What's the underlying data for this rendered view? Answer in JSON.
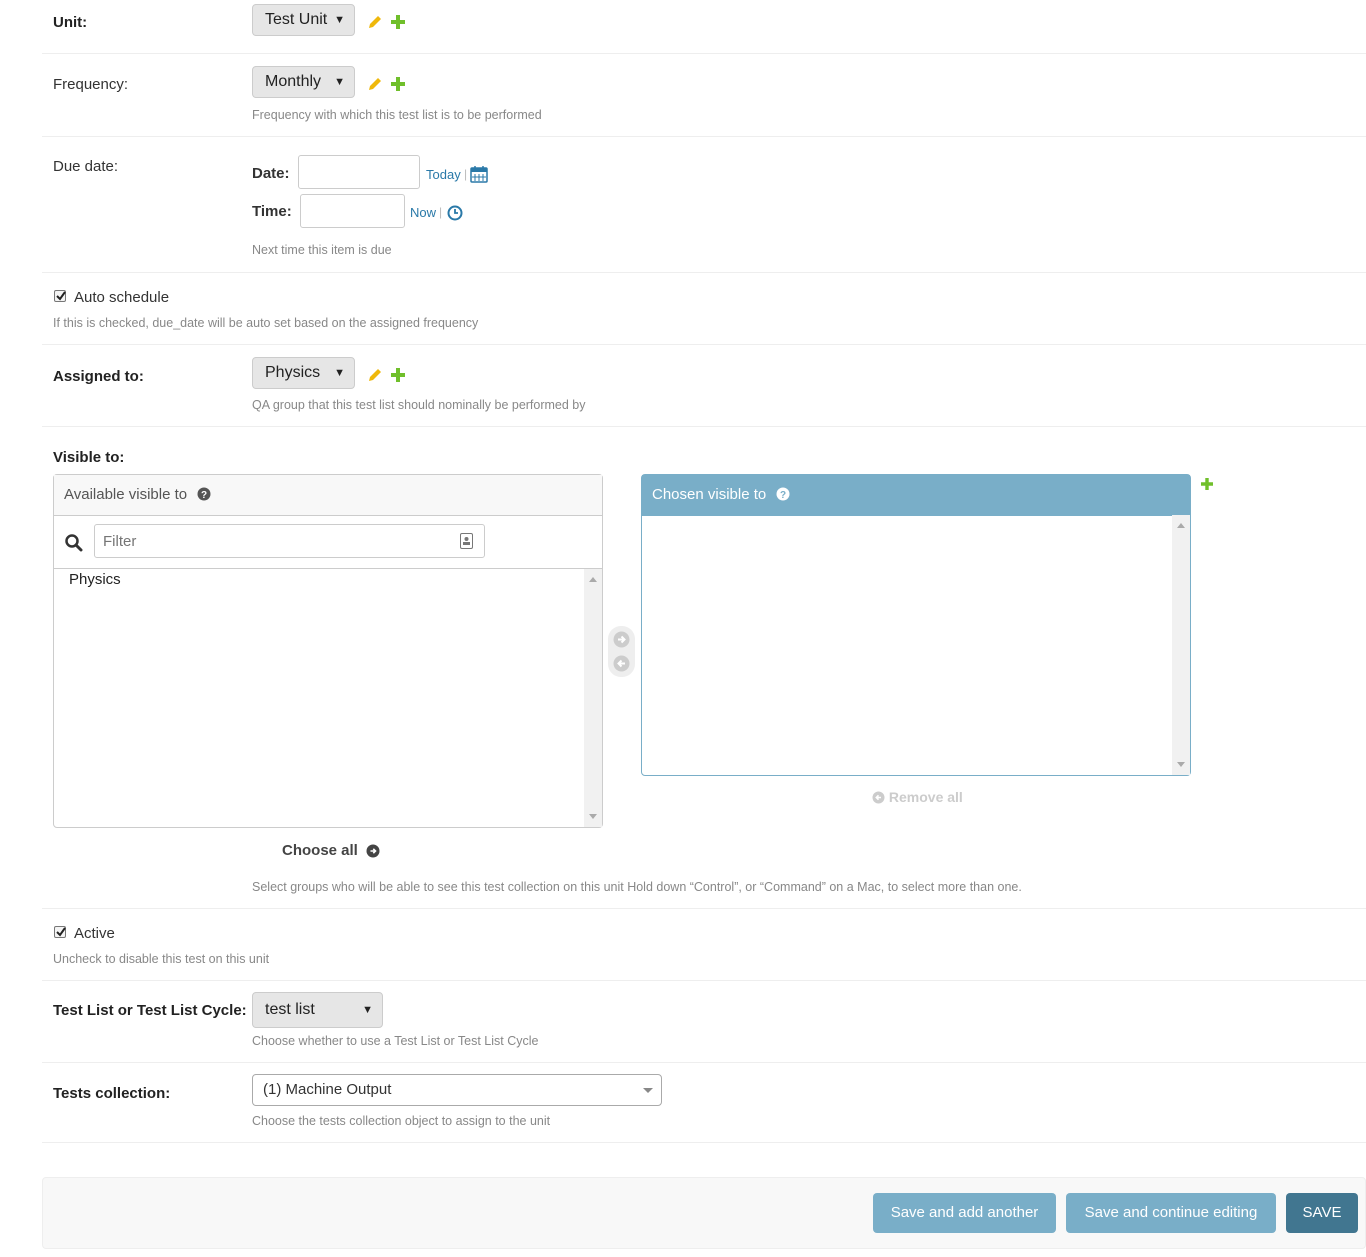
{
  "unit": {
    "label": "Unit:",
    "value": "Test Unit"
  },
  "frequency": {
    "label": "Frequency:",
    "value": "Monthly",
    "help": "Frequency with which this test list is to be performed"
  },
  "due_date": {
    "label": "Due date:",
    "date_label": "Date:",
    "date_value": "",
    "today_link": "Today",
    "separator": "|",
    "time_label": "Time:",
    "time_value": "",
    "now_link": "Now",
    "help": "Next time this item is due"
  },
  "auto_schedule": {
    "label": "Auto schedule",
    "checked": true,
    "help": "If this is checked, due_date will be auto set based on the assigned frequency"
  },
  "assigned_to": {
    "label": "Assigned to:",
    "value": "Physics",
    "help": "QA group that this test list should nominally be performed by"
  },
  "visible_to": {
    "label": "Visible to:",
    "available_title": "Available visible to",
    "filter_placeholder": "Filter",
    "available_items": [
      "Physics"
    ],
    "chosen_title": "Chosen visible to",
    "chosen_items": [],
    "choose_all": "Choose all",
    "remove_all": "Remove all",
    "help": "Select groups who will be able to see this test collection on this unit Hold down “Control”, or “Command” on a Mac, to select more than one."
  },
  "active": {
    "label": "Active",
    "checked": true,
    "help": "Uncheck to disable this test on this unit"
  },
  "test_list_type": {
    "label": "Test List or Test List Cycle:",
    "value": "test list",
    "help": "Choose whether to use a Test List or Test List Cycle"
  },
  "tests_collection": {
    "label": "Tests collection:",
    "value": "(1) Machine Output",
    "help": "Choose the tests collection object to assign to the unit"
  },
  "footer": {
    "save_add_another": "Save and add another",
    "save_continue": "Save and continue editing",
    "save": "SAVE"
  },
  "colors": {
    "accent": "#79aec8",
    "save": "#417690",
    "link": "#2a79a8",
    "add": "#70bf2b",
    "edit": "#efb80b"
  }
}
